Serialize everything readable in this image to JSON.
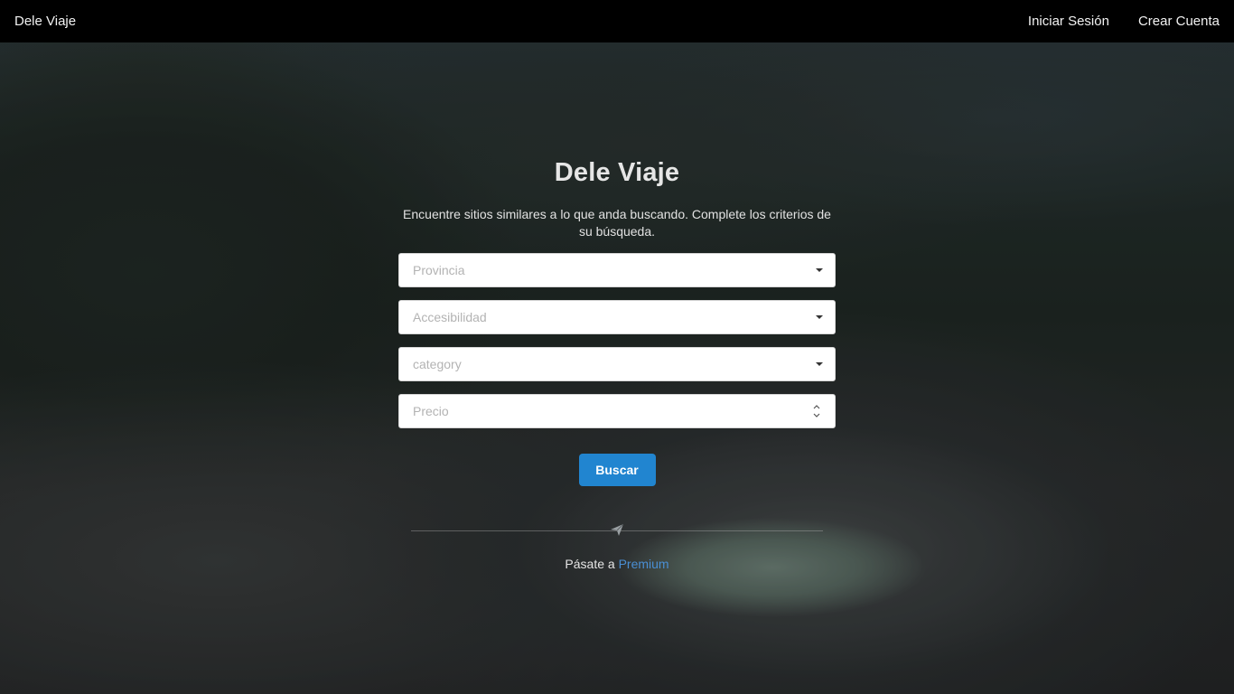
{
  "nav": {
    "brand": "Dele Viaje",
    "login": "Iniciar Sesión",
    "signup": "Crear Cuenta"
  },
  "hero": {
    "title": "Dele Viaje",
    "subtitle": "Encuentre sitios similares a lo que anda buscando. Complete los criterios de su búsqueda."
  },
  "form": {
    "provincia_placeholder": "Provincia",
    "accesibilidad_placeholder": "Accesibilidad",
    "category_placeholder": "category",
    "precio_placeholder": "Precio",
    "submit_label": "Buscar"
  },
  "footer": {
    "premium_prefix": "Pásate a",
    "premium_link": "Premium"
  },
  "icons": {
    "dropdown": "caret-down-icon",
    "number_spinner": "spinner-icon",
    "divider": "paper-plane-icon"
  },
  "colors": {
    "navbar": "#000000",
    "button": "#2185d0",
    "link": "#4a8fd4"
  }
}
